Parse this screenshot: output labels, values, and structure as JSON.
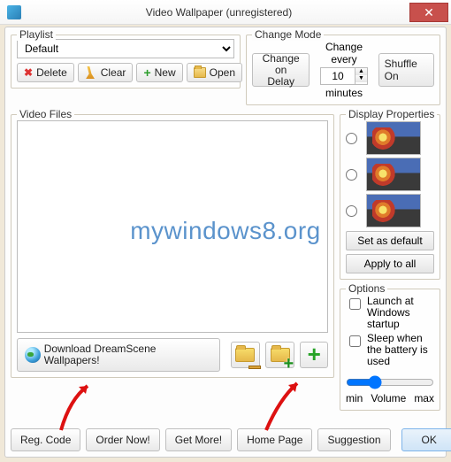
{
  "window": {
    "title": "Video Wallpaper (unregistered)"
  },
  "playlist": {
    "label": "Playlist",
    "selected": "Default",
    "buttons": {
      "delete": "Delete",
      "clear": "Clear",
      "new": "New",
      "open": "Open"
    }
  },
  "change_mode": {
    "label": "Change Mode",
    "change_on_delay": "Change on\nDelay",
    "change_every": "Change every",
    "value": "10",
    "unit": "minutes",
    "shuffle": "Shuffle On"
  },
  "video_files": {
    "label": "Video Files"
  },
  "download": {
    "label": "Download DreamScene Wallpapers!"
  },
  "display_props": {
    "label": "Display Properties",
    "set_default": "Set as default",
    "apply_all": "Apply to all"
  },
  "options": {
    "label": "Options",
    "launch": "Launch at Windows startup",
    "sleep": "Sleep when the battery is used",
    "vol_min": "min",
    "vol_label": "Volume",
    "vol_max": "max"
  },
  "bottom": {
    "reg": "Reg. Code",
    "order": "Order Now!",
    "get": "Get More!",
    "home": "Home Page",
    "sugg": "Suggestion",
    "ok": "OK"
  },
  "watermark": "mywindows8.org"
}
